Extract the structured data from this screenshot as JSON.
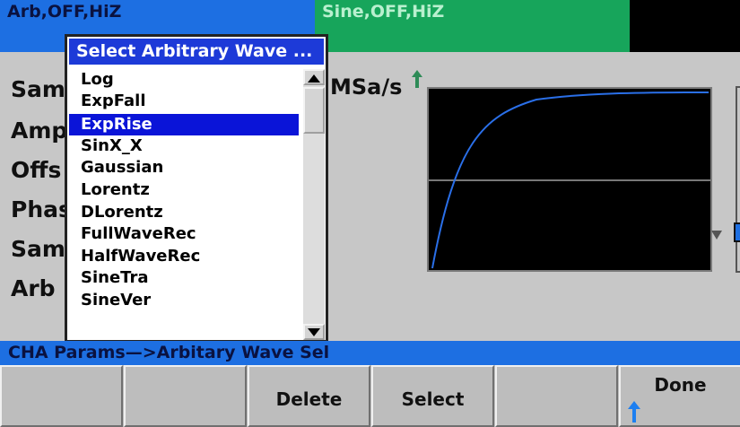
{
  "channels": {
    "ch1_label": "Arb,OFF,HiZ",
    "ch2_label": "Sine,OFF,HiZ"
  },
  "params": {
    "row1": "Samp",
    "row2": "Amp",
    "row3": "Offs",
    "row4": "Phas",
    "row5": "Sam",
    "row6": "Arb N",
    "rate_unit": "MSa/s"
  },
  "arb_list": {
    "title": "Select Arbitrary Wave ...",
    "items": [
      "Log",
      "ExpFall",
      "ExpRise",
      "SinX_X",
      "Gaussian",
      "Lorentz",
      "DLorentz",
      "FullWaveRec",
      "HalfWaveRec",
      "SineTra",
      "SineVer"
    ],
    "selected": "ExpRise"
  },
  "path": "CHA Params—>Arbitary Wave Sel",
  "softkeys": [
    "",
    "",
    "Delete",
    "Select",
    "",
    "Done"
  ],
  "colors": {
    "channel1": "#1d6fe2",
    "channel2": "#17a55b",
    "panel": "#c7c7c7",
    "selection": "#0a14d8",
    "waveform": "#2a6fe8",
    "marker": "#2e8b57"
  },
  "icons": {
    "trigger_marker": "up-arrow-icon",
    "done_arrow": "up-arrow-icon",
    "scroll_up": "triangle-up-icon",
    "scroll_down": "triangle-down-icon"
  }
}
